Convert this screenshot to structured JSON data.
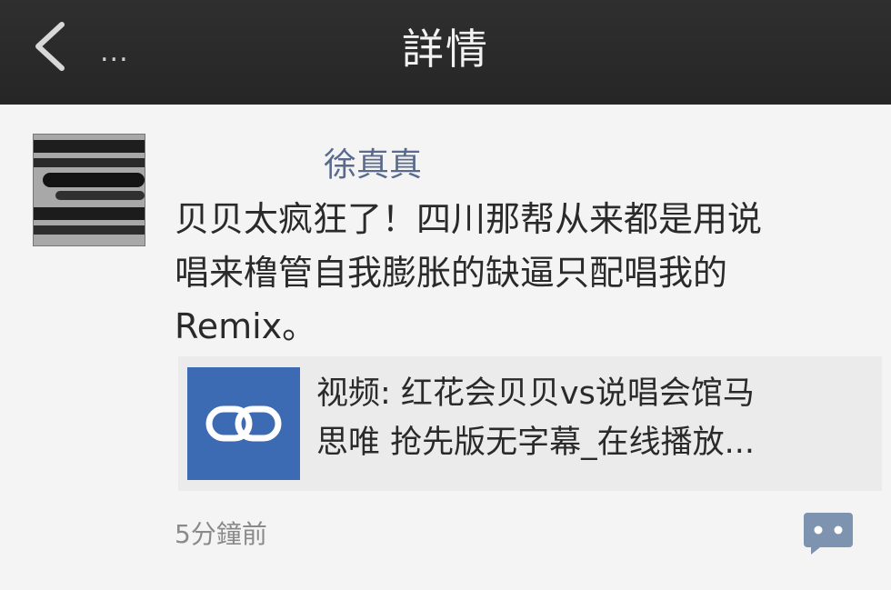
{
  "header": {
    "back_label": "...",
    "title": "詳情"
  },
  "post": {
    "author": "徐真真",
    "text_line1": "贝贝太疯狂了！四川那帮从来都是用说",
    "text_line2": "唱来橹管自我膨胀的缺逼只配唱我的",
    "text_line3": "Remix。",
    "link": {
      "title_line1": "视频: 红花会贝贝vs说唱会馆马",
      "title_line2": "思唯 抢先版无字幕_在线播放...",
      "icon": "link-icon"
    },
    "time": "5分鐘前"
  },
  "colors": {
    "header_bg": "#2b2b2b",
    "page_bg": "#f4f4f4",
    "author": "#5a6a8c",
    "link_thumb": "#3d6bb3",
    "comment_icon": "#7d93b0"
  }
}
